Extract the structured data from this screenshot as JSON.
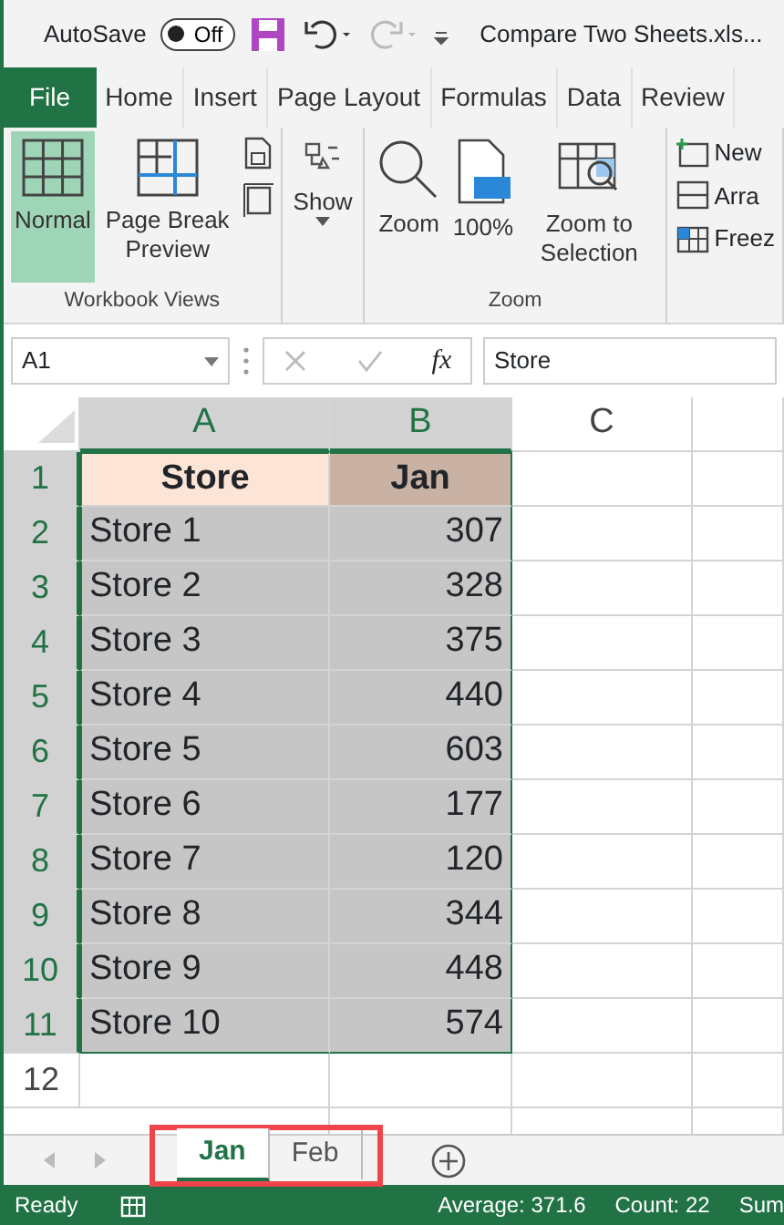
{
  "title_bar": {
    "autosave_label": "AutoSave",
    "autosave_toggle": {
      "label": "Off",
      "on": false
    },
    "filename": "Compare Two Sheets.xls..."
  },
  "ribbon_tabs": [
    {
      "label": "File",
      "kind": "file"
    },
    {
      "label": "Home",
      "kind": "tab"
    },
    {
      "label": "Insert",
      "kind": "tab"
    },
    {
      "label": "Page Layout",
      "kind": "tab"
    },
    {
      "label": "Formulas",
      "kind": "tab"
    },
    {
      "label": "Data",
      "kind": "tab"
    },
    {
      "label": "Review",
      "kind": "tab"
    }
  ],
  "ribbon_groups": [
    {
      "title": "Workbook Views",
      "buttons": [
        {
          "kind": "large",
          "label": "Normal",
          "selected": true
        },
        {
          "kind": "large",
          "label": "Page Break Preview",
          "selected": false
        },
        {
          "kind": "small-stack"
        }
      ]
    },
    {
      "buttons": [
        {
          "kind": "large",
          "label": "Show",
          "selected": false,
          "dropdown": true
        }
      ]
    },
    {
      "title": "Zoom",
      "buttons": [
        {
          "kind": "large",
          "label": "Zoom",
          "selected": false
        },
        {
          "kind": "large",
          "label": "100%",
          "selected": false
        },
        {
          "kind": "large",
          "label": "Zoom to Selection",
          "selected": false
        }
      ]
    },
    {
      "buttons": [
        {
          "kind": "list",
          "items": [
            {
              "label": "New"
            },
            {
              "label": "Arra"
            },
            {
              "label": "Freez"
            }
          ]
        }
      ]
    }
  ],
  "formula_bar": {
    "name_box": "A1",
    "fx": "fx",
    "value": "Store"
  },
  "columns": [
    {
      "label": "A",
      "selected": true
    },
    {
      "label": "B",
      "selected": true
    },
    {
      "label": "C",
      "selected": false
    }
  ],
  "rows": [
    {
      "number": "1",
      "selected": true,
      "kind": "header",
      "cells": [
        {
          "text": "Store",
          "color": "#fce4d6"
        },
        {
          "text": "Jan",
          "color": "#c9b1a4"
        }
      ]
    },
    {
      "number": "2",
      "selected": true,
      "kind": "data",
      "cells": [
        {
          "text": "Store 1"
        },
        {
          "text": "307"
        }
      ]
    },
    {
      "number": "3",
      "selected": true,
      "kind": "data",
      "cells": [
        {
          "text": "Store 2"
        },
        {
          "text": "328"
        }
      ]
    },
    {
      "number": "4",
      "selected": true,
      "kind": "data",
      "cells": [
        {
          "text": "Store 3"
        },
        {
          "text": "375"
        }
      ]
    },
    {
      "number": "5",
      "selected": true,
      "kind": "data",
      "cells": [
        {
          "text": "Store 4"
        },
        {
          "text": "440"
        }
      ]
    },
    {
      "number": "6",
      "selected": true,
      "kind": "data",
      "cells": [
        {
          "text": "Store 5"
        },
        {
          "text": "603"
        }
      ]
    },
    {
      "number": "7",
      "selected": true,
      "kind": "data",
      "cells": [
        {
          "text": "Store 6"
        },
        {
          "text": "177"
        }
      ]
    },
    {
      "number": "8",
      "selected": true,
      "kind": "data",
      "cells": [
        {
          "text": "Store 7"
        },
        {
          "text": "120"
        }
      ]
    },
    {
      "number": "9",
      "selected": true,
      "kind": "data",
      "cells": [
        {
          "text": "Store 8"
        },
        {
          "text": "344"
        }
      ]
    },
    {
      "number": "10",
      "selected": true,
      "kind": "data",
      "cells": [
        {
          "text": "Store 9"
        },
        {
          "text": "448"
        }
      ]
    },
    {
      "number": "11",
      "selected": true,
      "kind": "data",
      "cells": [
        {
          "text": "Store 10"
        },
        {
          "text": "574"
        }
      ]
    },
    {
      "number": "12",
      "selected": false,
      "kind": "empty",
      "cells": []
    }
  ],
  "sheet_tabs": [
    {
      "label": "Jan",
      "selected": true
    },
    {
      "label": "Feb",
      "selected": false
    }
  ],
  "status_bar": {
    "mode": "Ready",
    "average": "Average: 371.6",
    "count": "Count: 22",
    "sum": "Sum"
  }
}
